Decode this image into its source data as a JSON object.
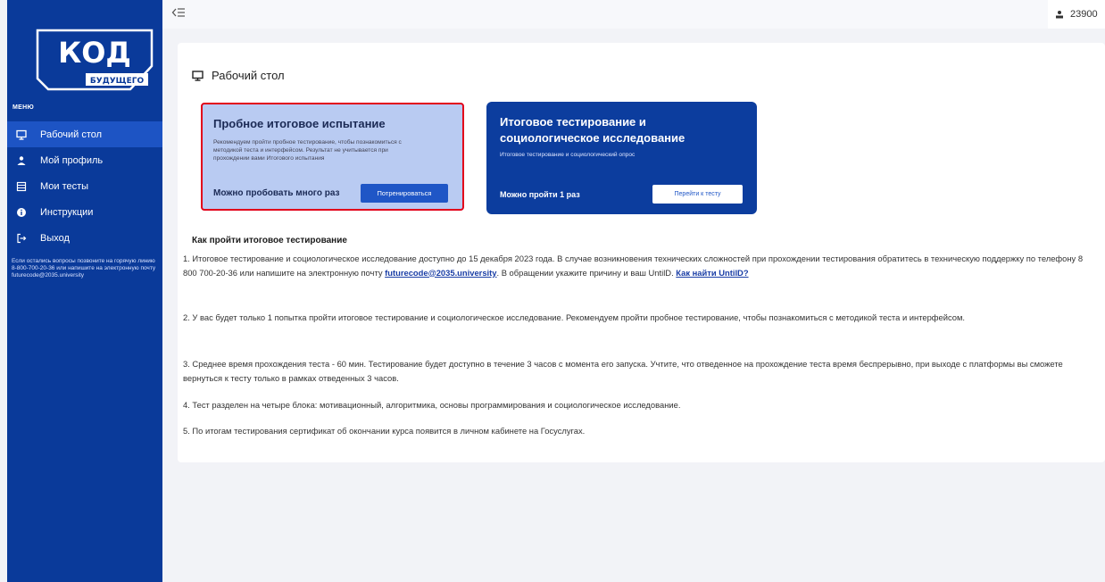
{
  "sidebar": {
    "logo_top": "КОД",
    "logo_bottom": "БУДУЩЕГО",
    "menu_label": "МЕНЮ",
    "items": [
      {
        "label": "Рабочий стол",
        "icon": "monitor-icon",
        "active": true
      },
      {
        "label": "Мой профиль",
        "icon": "user-icon",
        "active": false
      },
      {
        "label": "Мои тесты",
        "icon": "tests-icon",
        "active": false
      },
      {
        "label": "Инструкции",
        "icon": "info-icon",
        "active": false
      },
      {
        "label": "Выход",
        "icon": "logout-icon",
        "active": false
      }
    ],
    "note": "Если остались вопросы позвоните на горячую линию 8-800-700-20-36 или напишите на электронную почту futurecode@2035.university"
  },
  "topbar": {
    "user_id": "23900"
  },
  "main": {
    "title": "Рабочий стол",
    "cards": [
      {
        "title": "Пробное итоговое испытание",
        "description": "Рекомендуем пройти пробное тестирование, чтобы познакомиться с методикой теста и интерфейсом. Результат не учитывается при прохождении вами Итогового испытания",
        "note": "Можно пробовать много раз",
        "button": "Потренироваться"
      },
      {
        "title": "Итоговое тестирование и социологическое исследование",
        "description": "Итоговое тестирование и социологический опрос",
        "note": "Можно пройти 1 раз",
        "button": "Перейти к тесту"
      }
    ],
    "instructions_title": "Как пройти итоговое тестирование",
    "paragraphs": {
      "p1_text_a": "1. Итоговое тестирование и социологическое исследование доступно до 15 декабря 2023 года. В случае возникновения технических сложностей при прохождении тестирования обратитесь в техническую поддержку по телефону 8 800 700-20-36 или напишите на электронную почту ",
      "p1_email": "futurecode@2035.university",
      "p1_text_b": ". В обращении укажите причину и ваш UntilD. ",
      "p1_link": "Как найти UntilD?",
      "p2": "2. У вас будет только 1 попытка пройти итоговое тестирование и социологическое исследование. Рекомендуем пройти пробное тестирование, чтобы познакомиться с методикой теста и интерфейсом.",
      "p3": "3. Среднее время прохождения теста - 60 мин. Тестирование будет доступно в течение 3 часов с момента его запуска. Учтите, что отведенное на прохождение теста время беспрерывно, при выходе с платформы вы сможете вернуться к тесту только в рамках отведенных 3 часов.",
      "p4": "4. Тест разделен на четыре блока: мотивационный, алгоритмика, основы программирования и социологическое исследование.",
      "p5": "5. По итогам тестирования сертификат об окончании курса появится в личном кабинете на Госуслугах."
    }
  },
  "colors": {
    "sidebar_bg": "#0a3a9a",
    "sidebar_active": "#1d54c4",
    "card1_bg": "#b9cbf2",
    "card2_bg": "#0c3d9e",
    "highlight_border": "#e2001a",
    "link": "#1a3ea6"
  }
}
